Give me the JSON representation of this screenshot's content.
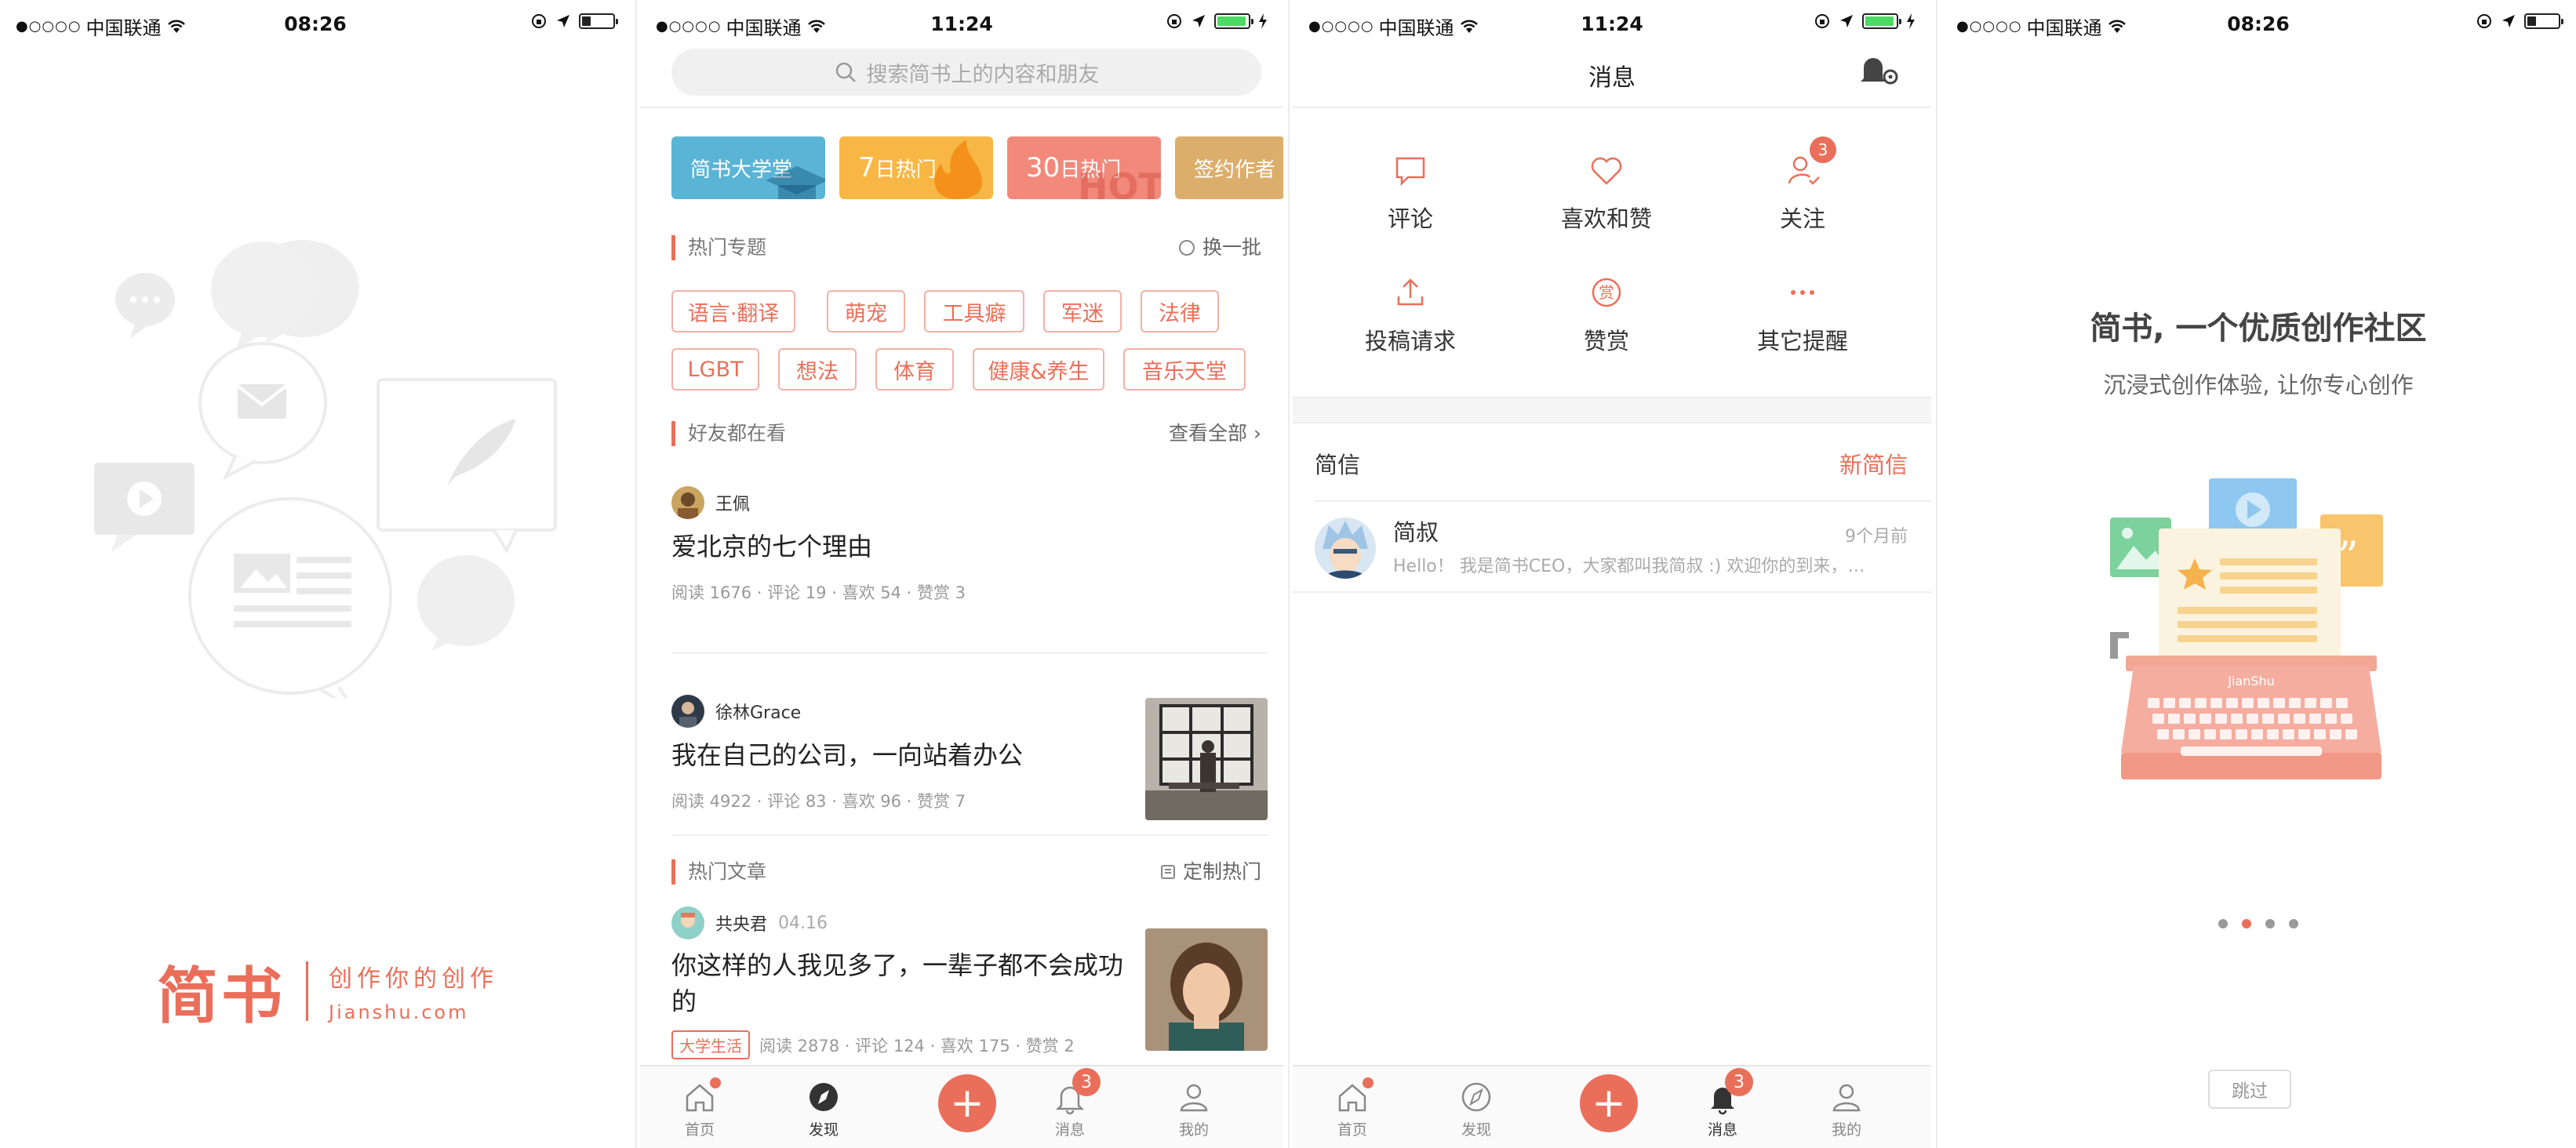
{
  "status_bars": [
    {
      "carrier": "中国联通",
      "signal_dots": "●○○○○",
      "time": "08:26",
      "battery_level": 0.3,
      "charging": false
    },
    {
      "carrier": "中国联通",
      "signal_dots": "●○○○○",
      "time": "11:24",
      "battery_level": 0.95,
      "charging": true
    },
    {
      "carrier": "中国联通",
      "signal_dots": "●○○○○",
      "time": "11:24",
      "battery_level": 0.95,
      "charging": true
    },
    {
      "carrier": "中国联通",
      "signal_dots": "●○○○○",
      "time": "08:26",
      "battery_level": 0.3,
      "charging": false
    }
  ],
  "splash": {
    "logo": "简书",
    "slogan": "创作你的创作",
    "domain": "Jianshu.com",
    "brand_color": "#ea6f5a"
  },
  "discover": {
    "search_placeholder": "搜索简书上的内容和朋友",
    "banners": [
      {
        "label": "简书大学堂",
        "color": "#5ab4d6"
      },
      {
        "num": "7",
        "label": "日热门",
        "color": "#f8b744"
      },
      {
        "num": "30",
        "label": "日热门",
        "color": "#f2897a"
      },
      {
        "label": "签约作者",
        "color": "#dcae6c"
      }
    ],
    "hot_topics": {
      "label": "热门专题",
      "action": "换一批",
      "tags_row1": [
        "语言·翻译",
        "萌宠",
        "工具癖",
        "军迷",
        "法律"
      ],
      "tags_row2": [
        "LGBT",
        "想法",
        "体育",
        "健康&养生",
        "音乐天堂"
      ]
    },
    "friends": {
      "label": "好友都在看",
      "action": "查看全部 ›"
    },
    "articles": [
      {
        "author": "王佩",
        "title": "爱北京的七个理由",
        "meta": "阅读 1676 · 评论 19 · 喜欢 54 · 赞赏 3"
      },
      {
        "author": "徐林Grace",
        "title": "我在自己的公司，一向站着办公",
        "meta": "阅读 4922 · 评论 83 · 喜欢 96 · 赞赏 7"
      }
    ],
    "hot_articles": {
      "label": "热门文章",
      "action": "定制热门",
      "items": [
        {
          "author": "共央君",
          "date": "04.16",
          "title_line1": "你这样的人我见多了，一辈子都不会成功",
          "title_line2": "的",
          "tag": "大学生活",
          "meta": "阅读 2878 · 评论 124 · 喜欢 175 · 赞赏 2"
        }
      ]
    }
  },
  "tabs": {
    "home": "首页",
    "discover": "发现",
    "messages": "消息",
    "mine": "我的",
    "message_badge": "3",
    "plus": "+"
  },
  "messages": {
    "title": "消息",
    "items": [
      {
        "label": "评论",
        "icon": "comment-icon"
      },
      {
        "label": "喜欢和赞",
        "icon": "heart-icon"
      },
      {
        "label": "关注",
        "icon": "follow-icon",
        "badge": "3"
      },
      {
        "label": "投稿请求",
        "icon": "upload-icon"
      },
      {
        "label": "赞赏",
        "icon": "reward-icon",
        "glyph": "赏"
      },
      {
        "label": "其它提醒",
        "icon": "more-icon"
      }
    ],
    "dm_label": "简信",
    "dm_new": "新简信",
    "dm": {
      "name": "简叔",
      "time": "9个月前",
      "preview": "Hello！ 我是简书CEO，大家都叫我简叔 :) 欢迎你的到来，…"
    }
  },
  "onboarding": {
    "title": "简书, 一个优质创作社区",
    "subtitle": "沉浸式创作体验, 让你专心创作",
    "typewriter_label": "JianShu",
    "page_count": 4,
    "active_page": 2,
    "skip": "跳过"
  }
}
